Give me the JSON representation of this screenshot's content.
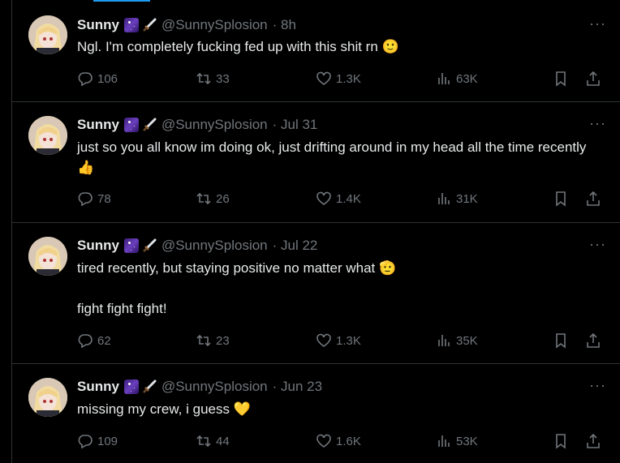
{
  "tweets": [
    {
      "name": "Sunny",
      "handle": "@SunnySplosion",
      "time": "· 8h",
      "text": "Ngl. I'm completely fucking fed up with this shit rn 🙂",
      "replies": "106",
      "reposts": "33",
      "likes": "1.3K",
      "views": "63K"
    },
    {
      "name": "Sunny",
      "handle": "@SunnySplosion",
      "time": "· Jul 31",
      "text": "just so you all know im doing ok, just drifting around in my head all the time recently 👍",
      "replies": "78",
      "reposts": "26",
      "likes": "1.4K",
      "views": "31K"
    },
    {
      "name": "Sunny",
      "handle": "@SunnySplosion",
      "time": "· Jul 22",
      "text": "tired recently, but staying positive no matter what 🫡",
      "text2": "fight fight fight!",
      "replies": "62",
      "reposts": "23",
      "likes": "1.3K",
      "views": "35K"
    },
    {
      "name": "Sunny",
      "handle": "@SunnySplosion",
      "time": "· Jun 23",
      "text": "missing my crew, i guess 💛",
      "replies": "109",
      "reposts": "44",
      "likes": "1.6K",
      "views": "53K"
    }
  ],
  "more_label": "···",
  "icons": [
    "reply-icon",
    "repost-icon",
    "like-icon",
    "views-icon",
    "bookmark-icon",
    "share-icon"
  ]
}
